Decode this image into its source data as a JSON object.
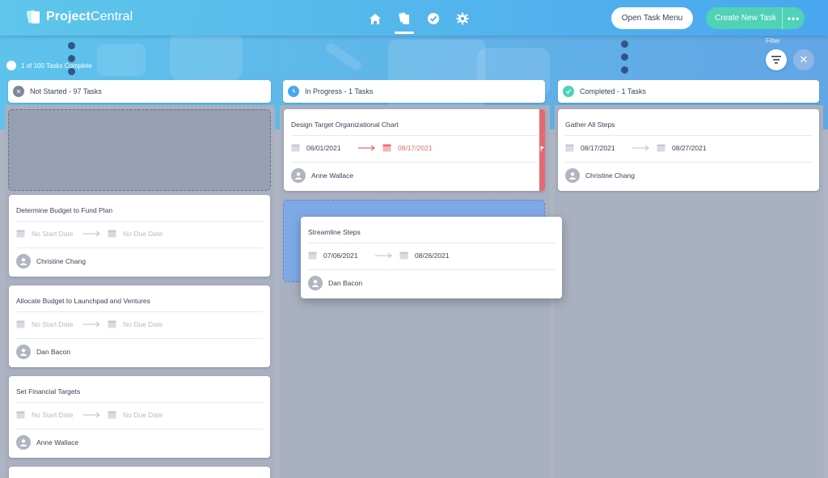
{
  "app": {
    "logo_prefix": "Project",
    "logo_suffix": "Central"
  },
  "nav": {
    "items": [
      "home-icon",
      "cards-icon",
      "check-icon",
      "gear-icon"
    ],
    "active": "cards-icon"
  },
  "header": {
    "open_task_menu": "Open Task Menu",
    "create_new_task": "Create New Task",
    "more": "•••"
  },
  "filter": {
    "label": "Filter",
    "clear": "✕"
  },
  "progress": {
    "text": "1 of 100 Tasks Complete"
  },
  "columns": [
    {
      "title": "Not Started - 97 Tasks",
      "icon": "x-circle-icon",
      "color": "#7f8799"
    },
    {
      "title": "In Progress - 1 Tasks",
      "icon": "clock-icon",
      "color": "#4aa7ef"
    },
    {
      "title": "Completed - 1 Tasks",
      "icon": "check-circle-icon",
      "color": "#4fd2b5"
    }
  ],
  "cards": {
    "ns1": {
      "title": "Determine Budget to Fund Plan",
      "start": "No Start Date",
      "due": "No Due Date",
      "assignee": "Christine Chang"
    },
    "ns2": {
      "title": "Allocate Budget to Launchpad and Ventures",
      "start": "No Start Date",
      "due": "No Due Date",
      "assignee": "Dan Bacon"
    },
    "ns3": {
      "title": "Set Financial Targets",
      "start": "No Start Date",
      "due": "No Due Date",
      "assignee": "Anne Wallace"
    },
    "ip1": {
      "title": "Design Target Organizational Chart",
      "start": "06/01/2021",
      "due": "08/17/2021",
      "assignee": "Anne Wallace"
    },
    "drag": {
      "title": "Streamline Steps",
      "start": "07/06/2021",
      "due": "08/26/2021",
      "assignee": "Dan Bacon"
    },
    "c1": {
      "title": "Gather All Steps",
      "start": "08/17/2021",
      "due": "08/27/2021",
      "assignee": "Christine Chang"
    }
  },
  "colors": {
    "accent": "#4aa7ef",
    "create": "#4fd2b5",
    "overdue": "#e46a72"
  }
}
